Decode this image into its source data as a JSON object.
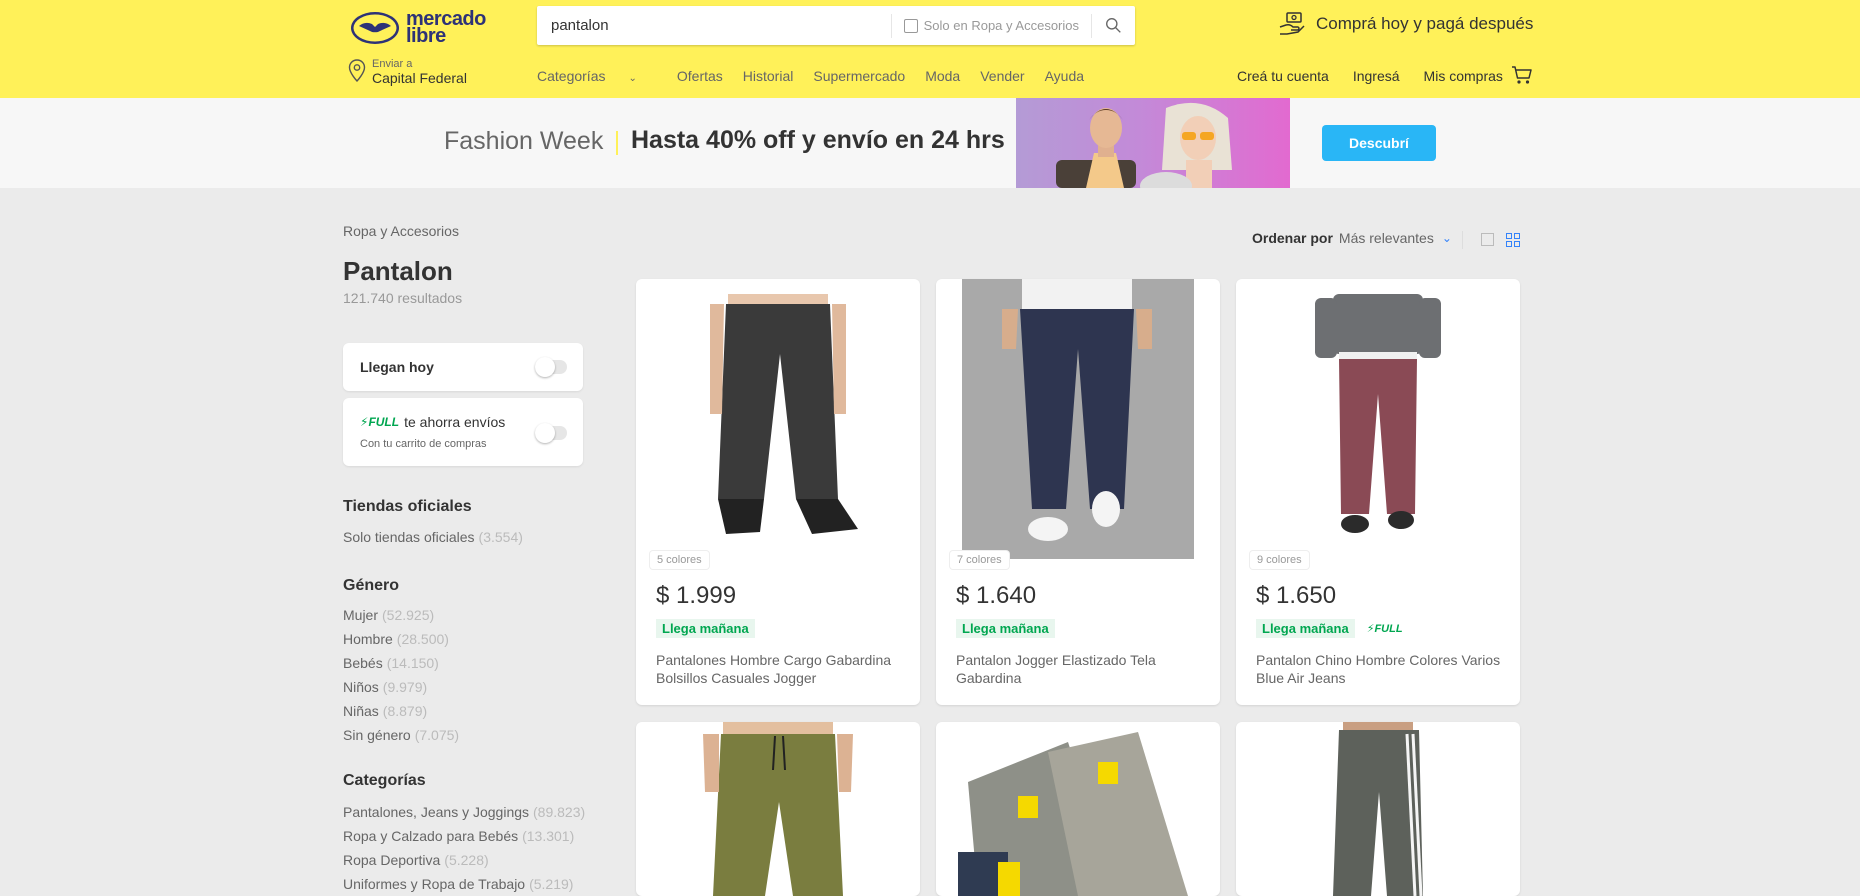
{
  "header": {
    "logo_text": "mercado libre",
    "search": {
      "value": "pantalon",
      "filter_label": "Solo en Ropa y Accesorios"
    },
    "promo": "Comprá hoy y pagá después",
    "location": {
      "small": "Enviar a",
      "main": "Capital Federal"
    },
    "nav": {
      "categorias": "Categorías",
      "ofertas": "Ofertas",
      "historial": "Historial",
      "supermercado": "Supermercado",
      "moda": "Moda",
      "vender": "Vender",
      "ayuda": "Ayuda"
    },
    "user": {
      "crea": "Creá tu cuenta",
      "ingresa": "Ingresá",
      "compras": "Mis compras"
    }
  },
  "banner": {
    "label": "Fashion Week",
    "headline": "Hasta 40% off y envío en 24 hrs",
    "button": "Descubrí"
  },
  "sidebar": {
    "breadcrumb": "Ropa y Accesorios",
    "title": "Pantalon",
    "results": "121.740 resultados",
    "llegan_hoy": "Llegan hoy",
    "full": {
      "badge": "FULL",
      "text": "te ahorra envíos",
      "sub": "Con tu carrito de compras"
    },
    "tiendas": {
      "title": "Tiendas oficiales",
      "items": [
        {
          "label": "Solo tiendas oficiales",
          "count": "(3.554)"
        }
      ]
    },
    "genero": {
      "title": "Género",
      "items": [
        {
          "label": "Mujer",
          "count": "(52.925)"
        },
        {
          "label": "Hombre",
          "count": "(28.500)"
        },
        {
          "label": "Bebés",
          "count": "(14.150)"
        },
        {
          "label": "Niños",
          "count": "(9.979)"
        },
        {
          "label": "Niñas",
          "count": "(8.879)"
        },
        {
          "label": "Sin género",
          "count": "(7.075)"
        }
      ]
    },
    "categorias": {
      "title": "Categorías",
      "items": [
        {
          "label": "Pantalones, Jeans y Joggings",
          "count": "(89.823)"
        },
        {
          "label": "Ropa y Calzado para Bebés",
          "count": "(13.301)"
        },
        {
          "label": "Ropa Deportiva",
          "count": "(5.228)"
        },
        {
          "label": "Uniformes y Ropa de Trabajo",
          "count": "(5.219)"
        }
      ]
    }
  },
  "results": {
    "sort_label": "Ordenar por",
    "sort_value": "Más relevantes",
    "products": [
      {
        "colors": "5 colores",
        "price": "$ 1.999",
        "shipping": "Llega mañana",
        "full": "",
        "title": "Pantalones Hombre Cargo Gabardina Bolsillos Casuales Jogger",
        "pants_color": "#3a3a3a"
      },
      {
        "colors": "7 colores",
        "price": "$ 1.640",
        "shipping": "Llega mañana",
        "full": "",
        "title": "Pantalon Jogger Elastizado Tela Gabardina",
        "pants_color": "#2e3550"
      },
      {
        "colors": "9 colores",
        "price": "$ 1.650",
        "shipping": "Llega mañana",
        "full": "FULL",
        "title": "Pantalon Chino Hombre Colores Varios Blue Air Jeans",
        "pants_color": "#8a4a55"
      },
      {
        "colors": "",
        "price": "",
        "shipping": "",
        "full": "",
        "title": "",
        "pants_color": "#7a7d3f"
      },
      {
        "colors": "",
        "price": "",
        "shipping": "",
        "full": "",
        "title": "",
        "pants_color": "#8e9088"
      },
      {
        "colors": "",
        "price": "",
        "shipping": "",
        "full": "",
        "title": "",
        "pants_color": "#5d615b"
      }
    ]
  },
  "colors": {
    "header_bg": "#fff159",
    "accent_blue": "#3483fa",
    "button_blue": "#29b6f6",
    "green": "#00a650"
  }
}
